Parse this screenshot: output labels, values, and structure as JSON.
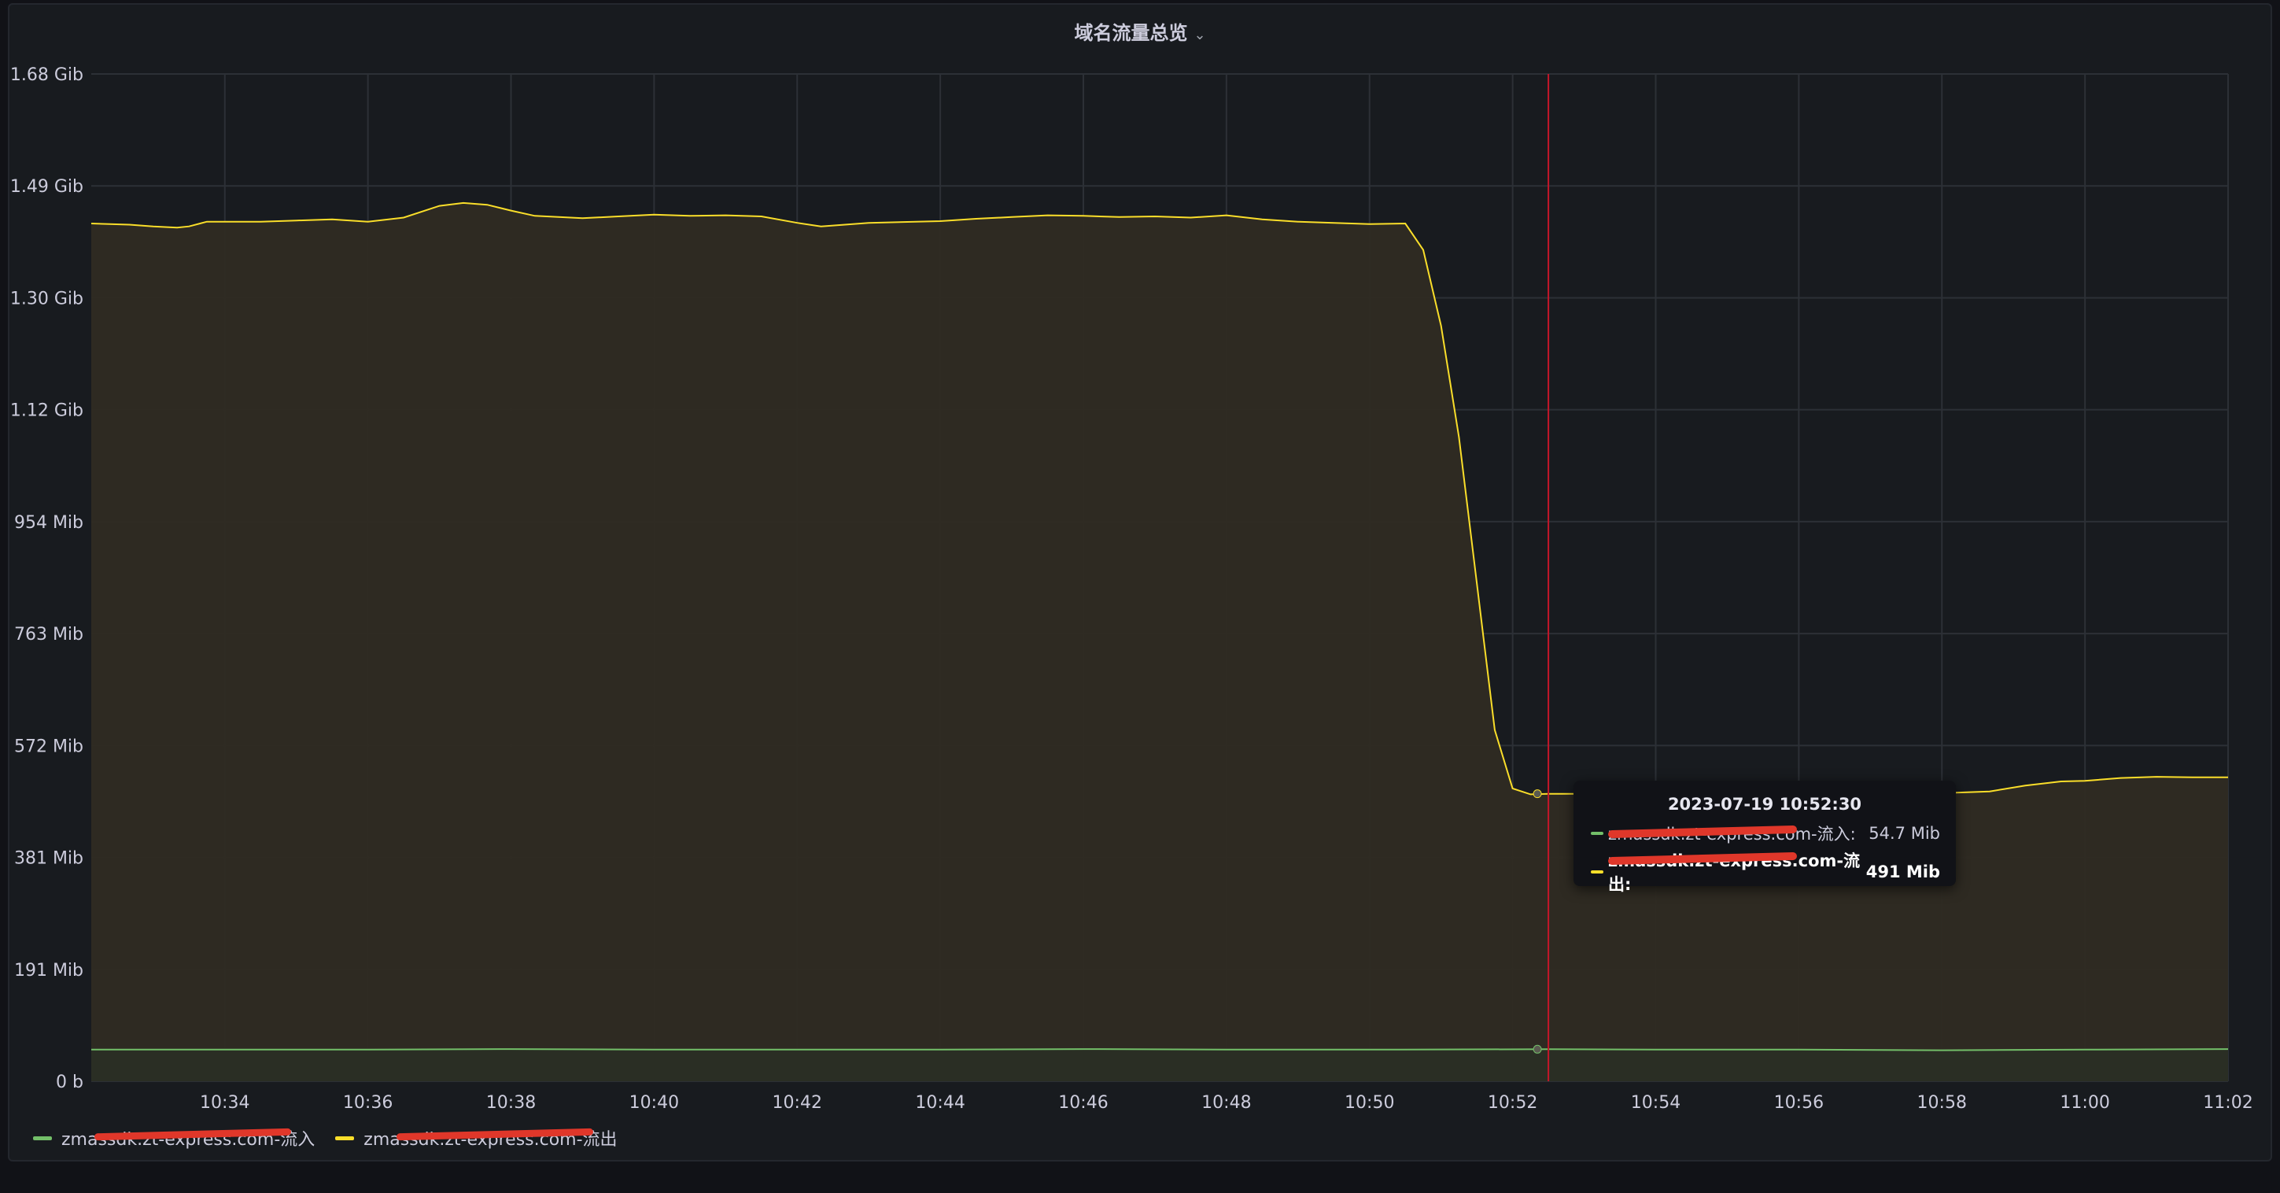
{
  "panel": {
    "title": "域名流量总览"
  },
  "colors": {
    "inbound": "#73bf69",
    "outbound": "#fade2a",
    "fill_outbound": "#2f2b23",
    "fill_inbound": "#2a2e25",
    "cursor": "#c4162a",
    "grid": "#2c3036"
  },
  "chart_data": {
    "type": "area",
    "ylim_bytes": [
      0,
      1803886264
    ],
    "y_tick_labels": [
      "0 b",
      "191 Mib",
      "381 Mib",
      "572 Mib",
      "763 Mib",
      "954 Mib",
      "1.12 Gib",
      "1.30 Gib",
      "1.49 Gib",
      "1.68 Gib"
    ],
    "x_tick_labels": [
      "10:34",
      "10:36",
      "10:38",
      "10:40",
      "10:42",
      "10:44",
      "10:46",
      "10:48",
      "10:50",
      "10:52",
      "10:54",
      "10:56",
      "10:58",
      "11:00",
      "11:02"
    ],
    "x_range": [
      "10:32:08",
      "11:02:00"
    ],
    "series": [
      {
        "name": "zmassdk.zt-express.com-流入",
        "unit": "Mib",
        "points": [
          [
            "10:32:08",
            54
          ],
          [
            "10:34:00",
            54
          ],
          [
            "10:36:00",
            54
          ],
          [
            "10:38:00",
            55
          ],
          [
            "10:40:00",
            54
          ],
          [
            "10:42:00",
            54
          ],
          [
            "10:44:00",
            54
          ],
          [
            "10:46:00",
            55
          ],
          [
            "10:48:00",
            54
          ],
          [
            "10:50:00",
            54
          ],
          [
            "10:52:30",
            54.7
          ],
          [
            "10:54:00",
            54
          ],
          [
            "10:56:00",
            54
          ],
          [
            "10:58:00",
            53
          ],
          [
            "11:00:00",
            54
          ],
          [
            "11:02:00",
            55
          ]
        ]
      },
      {
        "name": "zmassdk.zt-express.com-流出",
        "unit": "Mib",
        "points": [
          [
            "10:32:08",
            1465
          ],
          [
            "10:32:40",
            1463
          ],
          [
            "10:33:00",
            1460
          ],
          [
            "10:33:20",
            1458
          ],
          [
            "10:33:30",
            1460
          ],
          [
            "10:33:45",
            1468
          ],
          [
            "10:34:30",
            1468
          ],
          [
            "10:35:00",
            1470
          ],
          [
            "10:35:30",
            1472
          ],
          [
            "10:36:00",
            1468
          ],
          [
            "10:36:30",
            1475
          ],
          [
            "10:37:00",
            1495
          ],
          [
            "10:37:20",
            1500
          ],
          [
            "10:37:40",
            1497
          ],
          [
            "10:38:00",
            1487
          ],
          [
            "10:38:20",
            1478
          ],
          [
            "10:39:00",
            1474
          ],
          [
            "10:39:30",
            1477
          ],
          [
            "10:40:00",
            1480
          ],
          [
            "10:40:30",
            1478
          ],
          [
            "10:41:00",
            1479
          ],
          [
            "10:41:30",
            1477
          ],
          [
            "10:42:00",
            1466
          ],
          [
            "10:42:20",
            1460
          ],
          [
            "10:43:00",
            1466
          ],
          [
            "10:44:00",
            1469
          ],
          [
            "10:44:30",
            1473
          ],
          [
            "10:45:00",
            1476
          ],
          [
            "10:45:30",
            1479
          ],
          [
            "10:46:00",
            1478
          ],
          [
            "10:46:30",
            1476
          ],
          [
            "10:47:00",
            1477
          ],
          [
            "10:47:30",
            1475
          ],
          [
            "10:48:00",
            1479
          ],
          [
            "10:48:30",
            1472
          ],
          [
            "10:49:00",
            1468
          ],
          [
            "10:49:30",
            1466
          ],
          [
            "10:50:00",
            1464
          ],
          [
            "10:50:30",
            1465
          ],
          [
            "10:50:45",
            1420
          ],
          [
            "10:51:00",
            1290
          ],
          [
            "10:51:15",
            1100
          ],
          [
            "10:51:30",
            850
          ],
          [
            "10:51:45",
            600
          ],
          [
            "10:52:00",
            500
          ],
          [
            "10:52:15",
            490
          ],
          [
            "10:52:30",
            491
          ],
          [
            "10:53:00",
            491
          ],
          [
            "10:54:00",
            490
          ],
          [
            "10:55:00",
            489
          ],
          [
            "10:56:00",
            488
          ],
          [
            "10:57:00",
            488
          ],
          [
            "10:58:00",
            492
          ],
          [
            "10:58:40",
            495
          ],
          [
            "10:59:10",
            505
          ],
          [
            "10:59:40",
            512
          ],
          [
            "11:00:00",
            513
          ],
          [
            "11:00:30",
            518
          ],
          [
            "11:01:00",
            520
          ],
          [
            "11:01:30",
            519
          ],
          [
            "11:02:00",
            519
          ]
        ]
      }
    ],
    "cursor_time": "10:52:30",
    "grid": true,
    "legend_placement": "bottom-left"
  },
  "legend": [
    {
      "label": "zmassdk.zt-express.com-流入"
    },
    {
      "label": "zmassdk.zt-express.com-流出"
    }
  ],
  "tooltip": {
    "time": "2023-07-19 10:52:30",
    "rows": [
      {
        "label": "zmassdk.zt-express.com-流入:",
        "value": "54.7 Mib"
      },
      {
        "label": "zmassdk.zt-express.com-流出:",
        "value": "491 Mib"
      }
    ]
  }
}
